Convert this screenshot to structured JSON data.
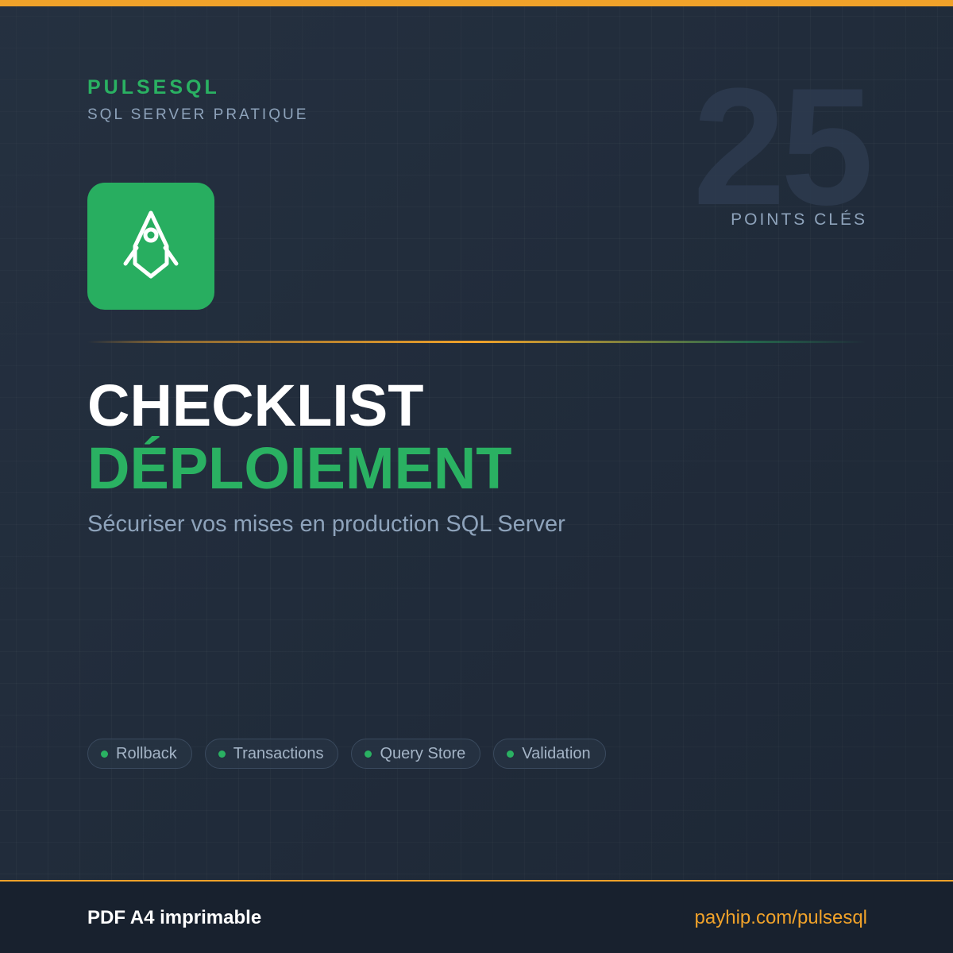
{
  "colors": {
    "background": "#212c3b",
    "accent_orange": "#f0a22a",
    "accent_green": "#2ab162",
    "muted_text": "#8ea3bb",
    "footer_background": "#18212e"
  },
  "header": {
    "brand": "PULSESQL",
    "tagline": "SQL SERVER PRATIQUE"
  },
  "badge": {
    "number": "25",
    "label": "POINTS CLÉS"
  },
  "logo": {
    "icon": "rocket-icon"
  },
  "title": {
    "line1": "CHECKLIST",
    "line2": "DÉPLOIEMENT"
  },
  "subtitle": "Sécuriser vos mises en production SQL Server",
  "tags": [
    {
      "label": "Rollback"
    },
    {
      "label": "Transactions"
    },
    {
      "label": "Query Store"
    },
    {
      "label": "Validation"
    }
  ],
  "footer": {
    "format": "PDF A4 imprimable",
    "link": "payhip.com/pulsesql"
  }
}
